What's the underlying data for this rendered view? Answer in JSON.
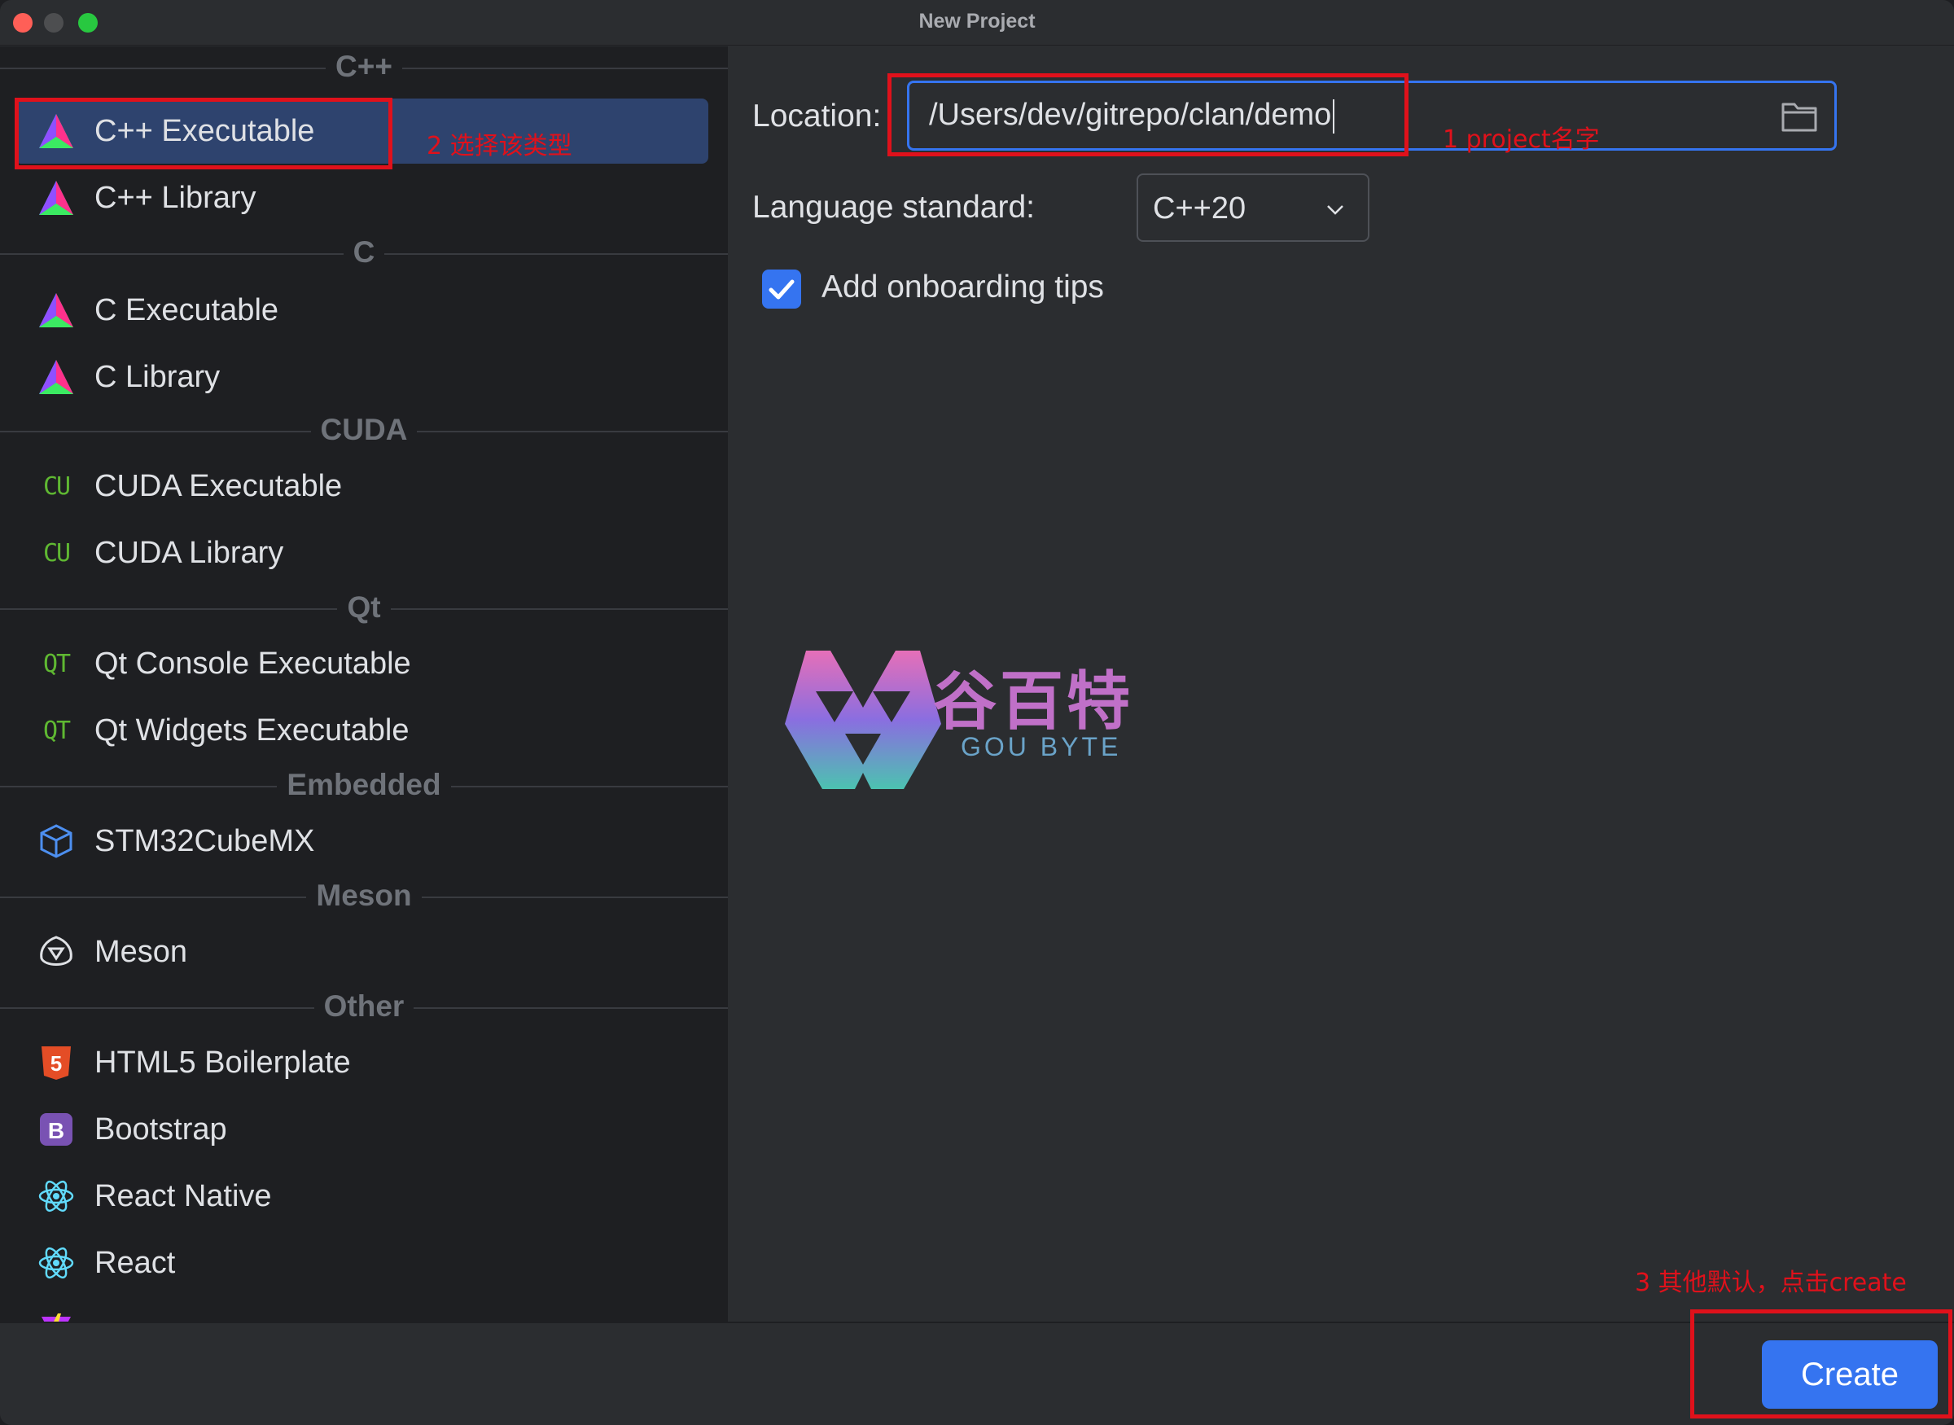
{
  "window": {
    "title": "New Project"
  },
  "sidebar": {
    "groups": [
      {
        "title": "C++",
        "items": [
          "C++ Executable",
          "C++ Library"
        ]
      },
      {
        "title": "C",
        "items": [
          "C Executable",
          "C Library"
        ]
      },
      {
        "title": "CUDA",
        "items": [
          "CUDA Executable",
          "CUDA Library"
        ]
      },
      {
        "title": "Qt",
        "items": [
          "Qt Console Executable",
          "Qt Widgets Executable"
        ]
      },
      {
        "title": "Embedded",
        "items": [
          "STM32CubeMX"
        ]
      },
      {
        "title": "Meson",
        "items": [
          "Meson"
        ]
      },
      {
        "title": "Other",
        "items": [
          "HTML5 Boilerplate",
          "Bootstrap",
          "React Native",
          "React"
        ]
      }
    ],
    "selected": "C++ Executable",
    "icons": {
      "clion": "clion-triangle-icon",
      "cuda": "cuda-icon",
      "qt": "qt-icon",
      "stm32": "cube-icon",
      "meson": "meson-icon",
      "html5": "html5-icon",
      "bootstrap": "bootstrap-icon",
      "react": "react-icon"
    }
  },
  "form": {
    "location_label": "Location:",
    "location_value": "/Users/dev/gitrepo/clan/demo",
    "language_label": "Language standard:",
    "language_value": "C++20",
    "onboarding_label": "Add onboarding tips",
    "onboarding_checked": true
  },
  "watermark": {
    "cn": "谷百特",
    "en": "GOU BYTE"
  },
  "footer": {
    "create_label": "Create"
  },
  "annotations": {
    "step1": "1 project名字",
    "step2": "2 选择该类型",
    "step3": "3 其他默认，点击create"
  },
  "colors": {
    "accent": "#3574f0",
    "annotation": "#e0111b",
    "selected_bg": "#2e436e"
  }
}
